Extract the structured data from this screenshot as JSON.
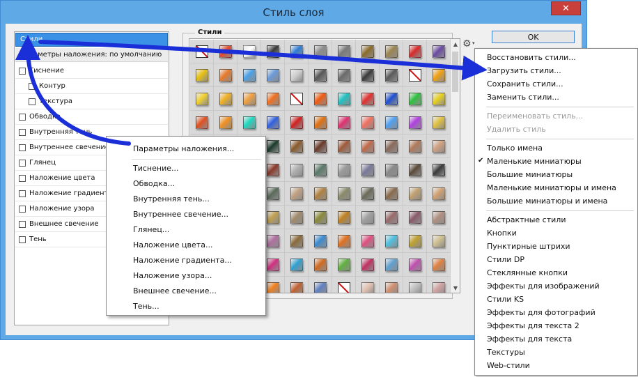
{
  "window": {
    "title": "Стиль слоя",
    "close_label": "✕"
  },
  "left_panel": {
    "header": "Стили",
    "subheader": "Параметры наложения: по умолчанию",
    "effects": [
      "Тиснение",
      "Контур",
      "Текстура",
      "Обводка",
      "Внутренняя тень",
      "Внутреннее свечение",
      "Глянец",
      "Наложение цвета",
      "Наложение градиента",
      "Наложение узора",
      "Внешнее свечение",
      "Тень"
    ]
  },
  "styles_panel": {
    "label": "Стили",
    "swatch_colors": [
      "none",
      "#e2482a",
      "#ffffff",
      "#3a3a3a",
      "#2f7bd6",
      "#8c8c8c",
      "#7a7a7a",
      "#8a6a2a",
      "#9c8450",
      "#d82a2a",
      "#6a4aa0",
      "#e8c010",
      "#e87a2a",
      "#4aa0e6",
      "#6a9ad8",
      "#d0d0d0",
      "#585858",
      "#6a6a6a",
      "#3a3a3a",
      "#5a5a5a",
      "none",
      "#f0a010",
      "#f0d030",
      "#f0b020",
      "#f0a040",
      "#f07020",
      "none",
      "#f05a10",
      "#20c0c0",
      "#e03030",
      "#2050d0",
      "#30c040",
      "#e8d020",
      "#e05020",
      "#f09020",
      "#20d8c0",
      "#3060e0",
      "#d02020",
      "#e07010",
      "#e03070",
      "#f07060",
      "#50a0f0",
      "#b040e0",
      "#e0c040",
      "#4a6a3a",
      "#6a2a2a",
      "#2a4a2a",
      "#1a3a2a",
      "#8a5a2a",
      "#6a3a2a",
      "#a05a3a",
      "#c06a4a",
      "#8a6a5a",
      "#b07a5a",
      "#d0a080",
      "#5a5a6a",
      "#5a4a4a",
      "#4a3a3a",
      "#8a3a2a",
      "#b0b0b0",
      "#5a7a6a",
      "#9a9a9a",
      "#7a7a9a",
      "#8a8a8a",
      "#5a4a3a",
      "#3a3a3a",
      "#4a5a4a",
      "#3a3a3a",
      "#6a6a6a",
      "#5a6a5a",
      "#c0a080",
      "#b08040",
      "#8a8a6a",
      "#6a6a5a",
      "#8a6a4a",
      "#c0a070",
      "#d0a070",
      "#6a8a4a",
      "#4a4a4a",
      "#7a5a3a",
      "#c0a050",
      "#a08a6a",
      "#8a8a3a",
      "#c08020",
      "#a0a0a0",
      "#9a6a6a",
      "#8a5a6a",
      "#b09080",
      "#c07a30",
      "#3a4a8a",
      "#6ab040",
      "#b070a0",
      "#8a6a3a",
      "#3a8ad0",
      "#e07020",
      "#e05080",
      "#50c0e0",
      "#c0a030",
      "#d0c090",
      "#d0a020",
      "#e03040",
      "none",
      "#d03080",
      "#30a0d0",
      "#d06a20",
      "#60b040",
      "#c03060",
      "#60a0d0",
      "#c050b0",
      "#e08040",
      "#c0c0c0",
      "#b0a080",
      "#f07010",
      "#f08020",
      "#c06030",
      "#6080c0",
      "none",
      "#e0c0b0",
      "#d09070",
      "#c0c0c0",
      "#d0a0a0",
      "#a08060",
      "#6a4a2a",
      "#a08a6a",
      "#8a6a2a",
      "#b0a080",
      "#6a6a6a",
      "#8a6a4a",
      "#c08060",
      "#a08070",
      "#c0a080",
      "#b09070"
    ]
  },
  "buttons": {
    "ok_label": "OK",
    "gear_icon": "⚙",
    "gear_caret": "▾"
  },
  "blending_popup": {
    "items": [
      "Параметры наложения...",
      "Тиснение...",
      "Обводка...",
      "Внутренняя тень...",
      "Внутреннее свечение...",
      "Глянец...",
      "Наложение цвета...",
      "Наложение градиента...",
      "Наложение узора...",
      "Внешнее свечение...",
      "Тень..."
    ]
  },
  "styles_menu": {
    "group1": [
      "Восстановить стили...",
      "Загрузить стили...",
      "Сохранить стили...",
      "Заменить стили..."
    ],
    "group2_disabled": [
      "Переименовать стиль...",
      "Удалить стиль"
    ],
    "group3": [
      "Только имена",
      "Маленькие миниатюры",
      "Большие миниатюры",
      "Маленькие миниатюры и имена",
      "Большие миниатюры и имена"
    ],
    "checked_view": "Маленькие миниатюры",
    "check_mark": "✔",
    "group4": [
      "Абстрактные стили",
      "Кнопки",
      "Пунктирные штрихи",
      "Стили DP",
      "Стеклянные кнопки",
      "Эффекты для изображений",
      "Стили KS",
      "Эффекты для фотографий",
      "Эффекты для текста 2",
      "Эффекты для текста",
      "Текстуры",
      "Web-стили"
    ]
  },
  "colors": {
    "arrow": "#1a2fd8",
    "title_bar": "#5fa9e6",
    "selection": "#3a91e6"
  }
}
